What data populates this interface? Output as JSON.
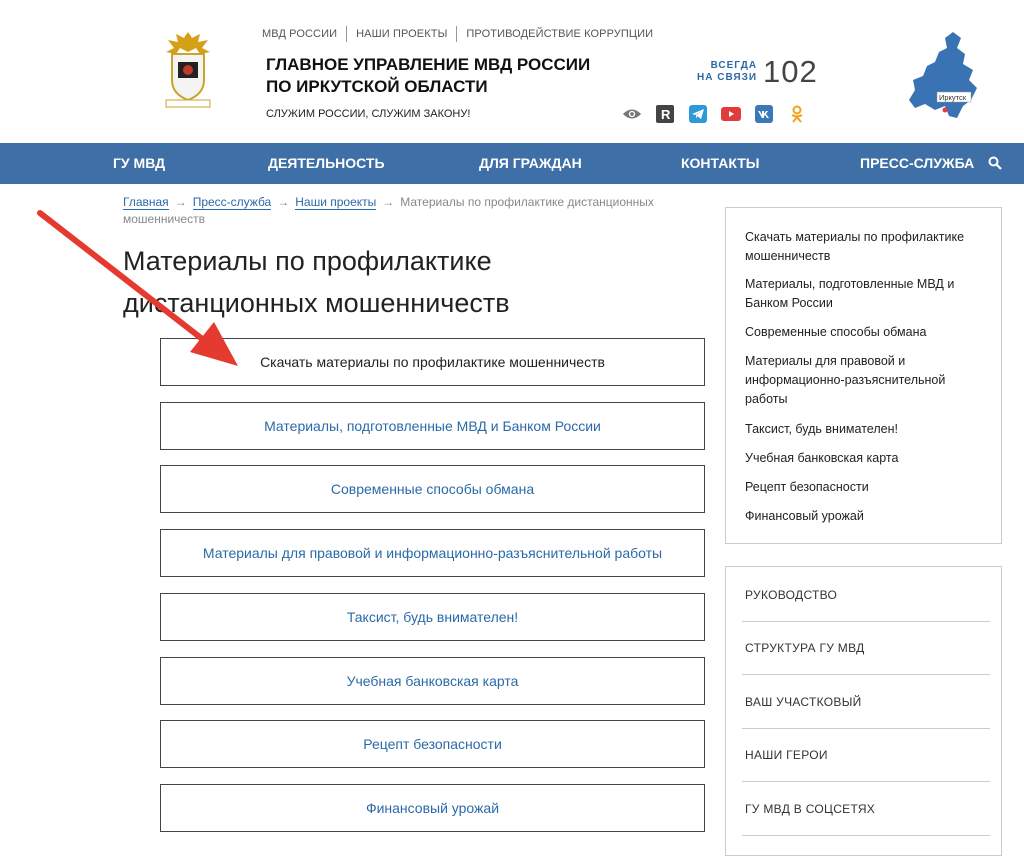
{
  "header": {
    "top_links": [
      "МВД РОССИИ",
      "НАШИ ПРОЕКТЫ",
      "ПРОТИВОДЕЙСТВИЕ КОРРУПЦИИ"
    ],
    "org_title_line1": "ГЛАВНОЕ УПРАВЛЕНИЕ МВД РОССИИ",
    "org_title_line2": "ПО ИРКУТСКОЙ ОБЛАСТИ",
    "slogan": "СЛУЖИМ РОССИИ, СЛУЖИМ ЗАКОНУ!",
    "always_line1": "ВСЕГДА",
    "always_line2": "НА СВЯЗИ",
    "phone": "102",
    "map_label": "Иркутск",
    "social_icons": [
      "eye-icon",
      "r-icon",
      "telegram-icon",
      "youtube-icon",
      "vk-icon",
      "ok-icon"
    ]
  },
  "nav": {
    "items": [
      "ГУ МВД",
      "ДЕЯТЕЛЬНОСТЬ",
      "ДЛЯ ГРАЖДАН",
      "КОНТАКТЫ",
      "ПРЕСС-СЛУЖБА"
    ]
  },
  "breadcrumb": {
    "links": [
      "Главная",
      "Пресс-служба",
      "Наши проекты"
    ],
    "current": "Материалы по профилактике дистанционных мошенничеств"
  },
  "page": {
    "title": "Материалы по профилактике дистанционных мошенничеств",
    "boxes": [
      "Скачать материалы по профилактике мошенничеств",
      "Материалы, подготовленные МВД и Банком России",
      "Современные способы обмана",
      "Материалы для правовой и информационно-разъяснительной работы",
      "Таксист, будь внимателен!",
      "Учебная банковская карта",
      "Рецепт безопасности",
      "Финансовый урожай"
    ]
  },
  "sidebar": {
    "links": [
      "Скачать материалы по профилактике мошенничеств",
      "Материалы, подготовленные МВД и Банком России",
      "Современные способы обмана",
      "Материалы для правовой и информационно-разъяснительной работы",
      "Таксист, будь внимателен!",
      "Учебная банковская карта",
      "Рецепт безопасности",
      "Финансовый урожай"
    ],
    "sections": [
      "РУКОВОДСТВО",
      "СТРУКТУРА ГУ МВД",
      "ВАШ УЧАСТКОВЫЙ",
      "НАШИ ГЕРОИ",
      "ГУ МВД В СОЦСЕТЯХ"
    ]
  },
  "colors": {
    "nav_bg": "#3e6fa6",
    "link": "#2b6aa8",
    "arrow": "#e53a2f"
  }
}
